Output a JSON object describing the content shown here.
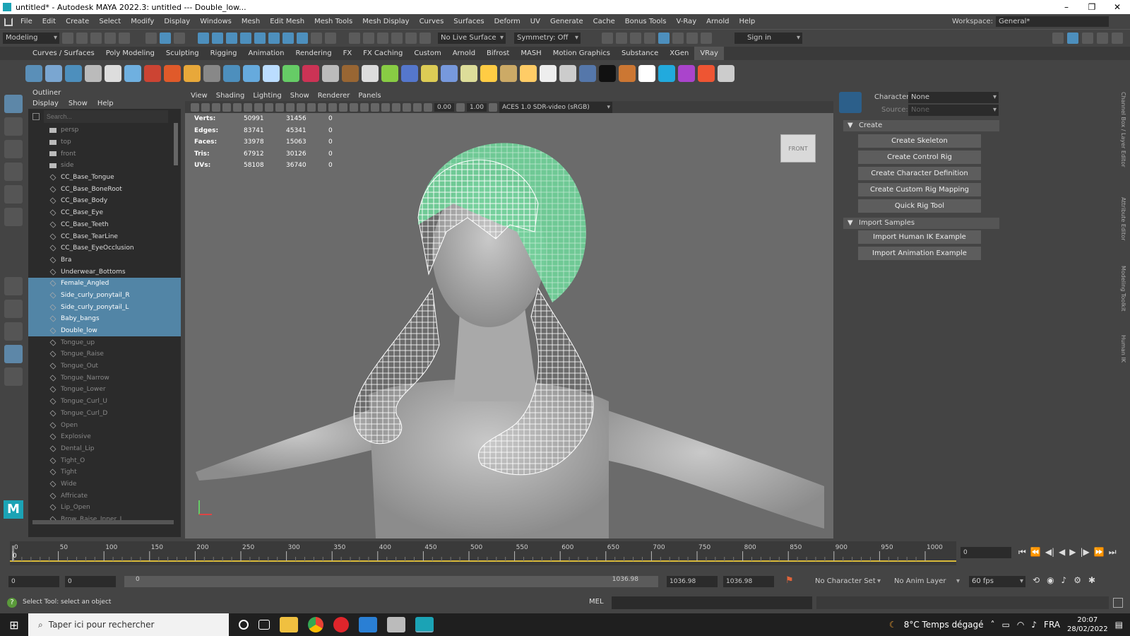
{
  "titlebar": {
    "title": "untitled* - Autodesk MAYA 2022.3: untitled   ---   Double_low...",
    "minimize": "–",
    "maximize": "❐",
    "close": "✕"
  },
  "menubar": {
    "items": [
      "File",
      "Edit",
      "Create",
      "Select",
      "Modify",
      "Display",
      "Windows",
      "Mesh",
      "Edit Mesh",
      "Mesh Tools",
      "Mesh Display",
      "Curves",
      "Surfaces",
      "Deform",
      "UV",
      "Generate",
      "Cache",
      "Bonus Tools",
      "V-Ray",
      "Arnold",
      "Help"
    ],
    "workspace_label": "Workspace:",
    "workspace_value": "General*"
  },
  "statusline": {
    "mode": "Modeling",
    "live_surface": "No Live Surface",
    "symmetry": "Symmetry: Off",
    "signin": "Sign in"
  },
  "shelf_tabs": [
    "Curves / Surfaces",
    "Poly Modeling",
    "Sculpting",
    "Rigging",
    "Animation",
    "Rendering",
    "FX",
    "FX Caching",
    "Custom",
    "Arnold",
    "Bifrost",
    "MASH",
    "Motion Graphics",
    "Substance",
    "XGen",
    "VRay"
  ],
  "shelf_icon_colors": [
    "#5a8fb8",
    "#7aa6d1",
    "#4d8fbd",
    "#bbbbbb",
    "#dddddd",
    "#6fb0e0",
    "#cc4433",
    "#e05a2a",
    "#e8a83a",
    "#888888",
    "#4d8fbd",
    "#66aadd",
    "#bbddff",
    "#66cc66",
    "#cc3355",
    "#bbbbbb",
    "#996633",
    "#dddddd",
    "#88cc44",
    "#5577cc",
    "#ddcc55",
    "#7799dd",
    "#dddd99",
    "#ffcc44",
    "#ccaa66",
    "#ffcc66",
    "#eeeeee",
    "#cccccc",
    "#5577aa",
    "#111111",
    "#cc7733",
    "#ffffff",
    "#22aadd",
    "#aa44cc",
    "#ee5533",
    "#cccccc"
  ],
  "outliner": {
    "title": "Outliner",
    "menu": [
      "Display",
      "Show",
      "Help"
    ],
    "search_placeholder": "Search...",
    "rows": [
      {
        "label": "persp",
        "kind": "cam",
        "state": "dim"
      },
      {
        "label": "top",
        "kind": "cam",
        "state": "dim"
      },
      {
        "label": "front",
        "kind": "cam",
        "state": "dim"
      },
      {
        "label": "side",
        "kind": "cam",
        "state": "dim"
      },
      {
        "label": "CC_Base_Tongue",
        "kind": "mesh",
        "state": ""
      },
      {
        "label": "CC_Base_BoneRoot",
        "kind": "joint",
        "state": ""
      },
      {
        "label": "CC_Base_Body",
        "kind": "mesh",
        "state": ""
      },
      {
        "label": "CC_Base_Eye",
        "kind": "mesh",
        "state": ""
      },
      {
        "label": "CC_Base_Teeth",
        "kind": "mesh",
        "state": ""
      },
      {
        "label": "CC_Base_TearLine",
        "kind": "mesh",
        "state": ""
      },
      {
        "label": "CC_Base_EyeOcclusion",
        "kind": "mesh",
        "state": ""
      },
      {
        "label": "Bra",
        "kind": "mesh",
        "state": ""
      },
      {
        "label": "Underwear_Bottoms",
        "kind": "mesh",
        "state": ""
      },
      {
        "label": "Female_Angled",
        "kind": "mesh",
        "state": "sel"
      },
      {
        "label": "Side_curly_ponytail_R",
        "kind": "mesh",
        "state": "sel"
      },
      {
        "label": "Side_curly_ponytail_L",
        "kind": "mesh",
        "state": "sel"
      },
      {
        "label": "Baby_bangs",
        "kind": "mesh",
        "state": "sel"
      },
      {
        "label": "Double_low",
        "kind": "mesh",
        "state": "sel"
      },
      {
        "label": "Tongue_up",
        "kind": "mesh",
        "state": "dim"
      },
      {
        "label": "Tongue_Raise",
        "kind": "mesh",
        "state": "dim"
      },
      {
        "label": "Tongue_Out",
        "kind": "mesh",
        "state": "dim"
      },
      {
        "label": "Tongue_Narrow",
        "kind": "mesh",
        "state": "dim"
      },
      {
        "label": "Tongue_Lower",
        "kind": "mesh",
        "state": "dim"
      },
      {
        "label": "Tongue_Curl_U",
        "kind": "mesh",
        "state": "dim"
      },
      {
        "label": "Tongue_Curl_D",
        "kind": "mesh",
        "state": "dim"
      },
      {
        "label": "Open",
        "kind": "mesh",
        "state": "dim"
      },
      {
        "label": "Explosive",
        "kind": "mesh",
        "state": "dim"
      },
      {
        "label": "Dental_Lip",
        "kind": "mesh",
        "state": "dim"
      },
      {
        "label": "Tight_O",
        "kind": "mesh",
        "state": "dim"
      },
      {
        "label": "Tight",
        "kind": "mesh",
        "state": "dim"
      },
      {
        "label": "Wide",
        "kind": "mesh",
        "state": "dim"
      },
      {
        "label": "Affricate",
        "kind": "mesh",
        "state": "dim"
      },
      {
        "label": "Lip_Open",
        "kind": "mesh",
        "state": "dim"
      },
      {
        "label": "Brow_Raise_Inner_L",
        "kind": "mesh",
        "state": "dim"
      }
    ]
  },
  "viewport": {
    "menu": [
      "View",
      "Shading",
      "Lighting",
      "Show",
      "Renderer",
      "Panels"
    ],
    "exposure": "0.00",
    "gamma": "1.00",
    "colorspace": "ACES 1.0 SDR-video (sRGB)",
    "viewcube_label": "FRONT",
    "hud": [
      {
        "label": "Verts:",
        "a": "50991",
        "b": "31456",
        "c": "0"
      },
      {
        "label": "Edges:",
        "a": "83741",
        "b": "45341",
        "c": "0"
      },
      {
        "label": "Faces:",
        "a": "33978",
        "b": "15063",
        "c": "0"
      },
      {
        "label": "Tris:",
        "a": "67912",
        "b": "30126",
        "c": "0"
      },
      {
        "label": "UVs:",
        "a": "58108",
        "b": "36740",
        "c": "0"
      }
    ]
  },
  "hik": {
    "character_label": "Character:",
    "character_value": "None",
    "source_label": "Source:",
    "source_value": "None",
    "create_section": "Create",
    "create_buttons": [
      "Create Skeleton",
      "Create Control Rig",
      "Create Character Definition",
      "Create Custom Rig Mapping",
      "Quick Rig Tool"
    ],
    "import_section": "Import Samples",
    "import_buttons": [
      "Import Human IK Example",
      "Import Animation Example"
    ]
  },
  "side_tabs": [
    "Channel Box / Layer Editor",
    "Attribute Editor",
    "Modeling Toolkit",
    "Human IK"
  ],
  "timeline": {
    "ticks": [
      "0",
      "50",
      "100",
      "150",
      "200",
      "250",
      "300",
      "350",
      "400",
      "450",
      "500",
      "550",
      "600",
      "650",
      "700",
      "750",
      "800",
      "850",
      "900",
      "950",
      "1000"
    ],
    "current_frame": "0",
    "frame_field": "0"
  },
  "range": {
    "start": "0",
    "range_start": "0",
    "slider_start": "0",
    "slider_end": "1036.98",
    "range_end": "1036.98",
    "end": "1036.98",
    "char_set": "No Character Set",
    "anim_layer": "No Anim Layer",
    "fps": "60 fps"
  },
  "helpline": {
    "text": "Select Tool: select an object",
    "mel": "MEL"
  },
  "taskbar": {
    "search": "Taper ici pour rechercher",
    "weather": "8°C  Temps dégagé",
    "lang": "FRA",
    "time": "20:07",
    "date": "28/02/2022"
  }
}
